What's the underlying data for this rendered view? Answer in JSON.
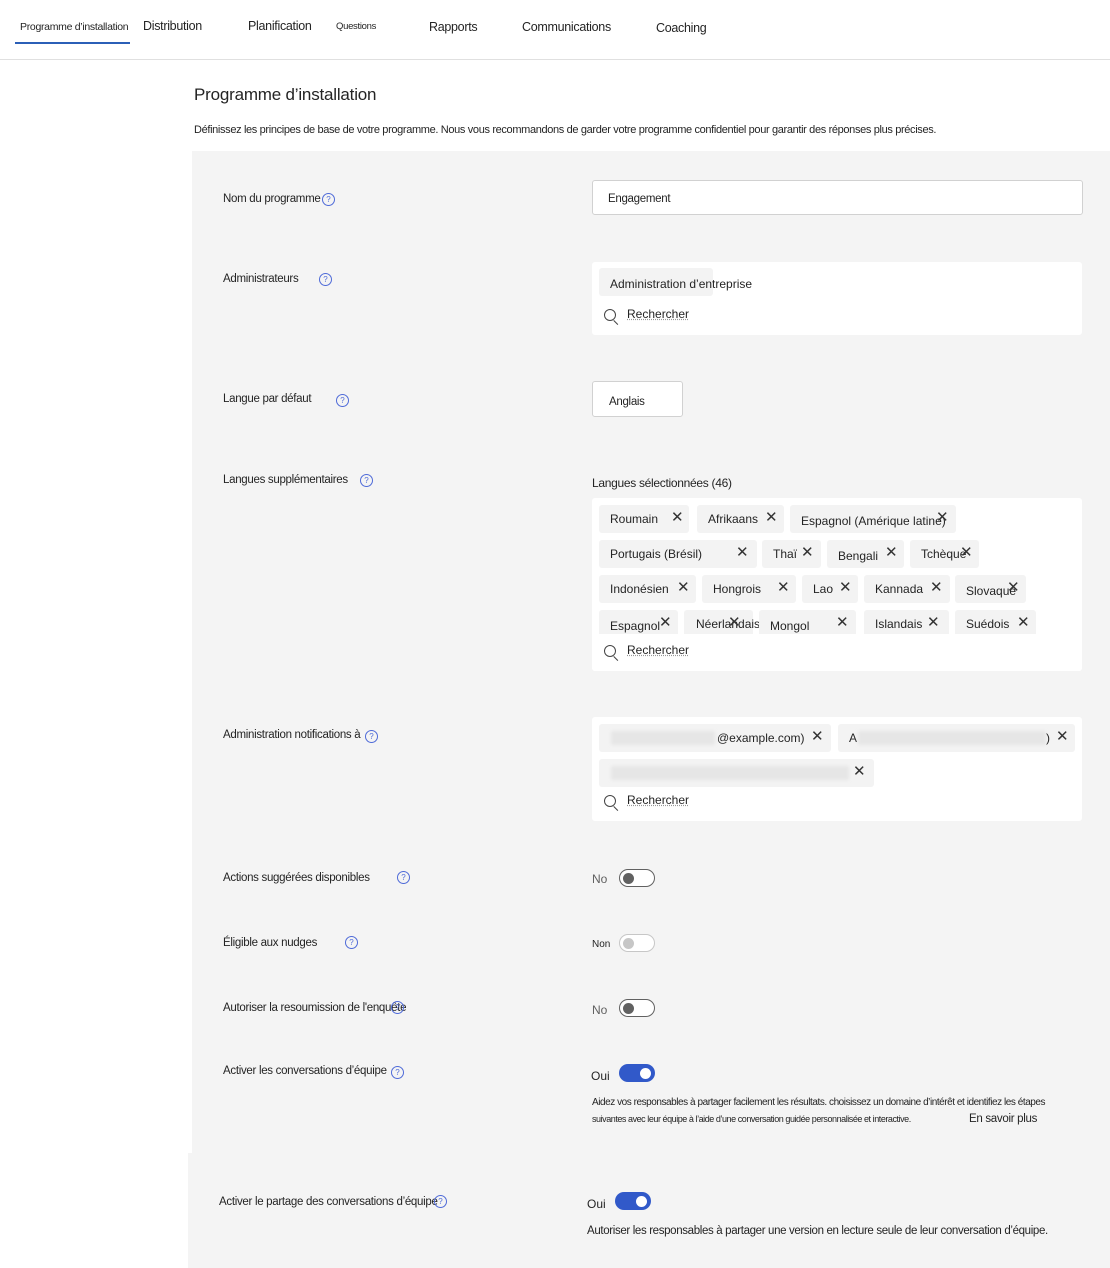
{
  "nav": {
    "tabs": [
      {
        "label": "Programme d’installation",
        "active": true
      },
      {
        "label": "Distribution"
      },
      {
        "label": "Planification"
      },
      {
        "label": "Questions"
      },
      {
        "label": "Rapports"
      },
      {
        "label": "Communications"
      },
      {
        "label": "Coaching"
      }
    ]
  },
  "page": {
    "title": "Programme d’installation",
    "description": "Définissez les principes de base de votre programme. Nous vous recommandons de garder votre programme confidentiel pour garantir des réponses plus précises."
  },
  "help_glyph": "?",
  "remove_glyph": "✕",
  "fields": {
    "program_name": {
      "label": "Nom du programme",
      "value": "Engagement"
    },
    "admins": {
      "label": "Administrateurs",
      "chips": [
        "Administration d’entreprise"
      ],
      "search_placeholder": "Rechercher"
    },
    "default_language": {
      "label": "Langue par défaut",
      "value": "Anglais"
    },
    "additional_languages": {
      "label": "Langues supplémentaires",
      "selected_label": "Langues sélectionnées (46)",
      "chips": [
        "Roumain",
        "Afrikaans",
        "Espagnol (Amérique latine)",
        "Portugais (Brésil)",
        "Thaï",
        "Bengali",
        "Tchèque",
        "Indonésien",
        "Hongrois",
        "Lao",
        "Kannada",
        "Slovaque",
        "Espagnol",
        "Néerlandais",
        "Mongol",
        "Islandais",
        "Suédois"
      ],
      "search_placeholder": "Rechercher"
    },
    "admin_notifications": {
      "label": "Administration notifications à",
      "chips": [
        "@example.com)",
        "A",
        ")",
        ""
      ],
      "search_placeholder": "Rechercher"
    },
    "suggested_actions": {
      "label": "Actions suggérées disponibles",
      "state_label": "No",
      "enabled": false
    },
    "nudges": {
      "label": "Éligible aux nudges",
      "state_label": "Non",
      "enabled": false,
      "disabled": true
    },
    "resubmission": {
      "label": "Autoriser la resoumission de l'enquête",
      "state_label": "No",
      "enabled": false
    },
    "team_conversations": {
      "label": "Activer les conversations d’équipe",
      "state_label": "Oui",
      "enabled": true,
      "help_line1": "Aidez vos responsables à partager facilement les résultats. choisissez un domaine d’intérêt et identifiez les étapes",
      "help_line2": "suivantes avec leur équipe à l’aide d’une conversation guidée personnalisée et interactive.",
      "learn_more": "En savoir plus"
    },
    "team_conversation_sharing": {
      "label": "Activer le partage des conversations d’équipe",
      "state_label": "Oui",
      "enabled": true,
      "help": "Autoriser les responsables à partager une version en lecture seule de leur conversation d’équipe."
    }
  }
}
